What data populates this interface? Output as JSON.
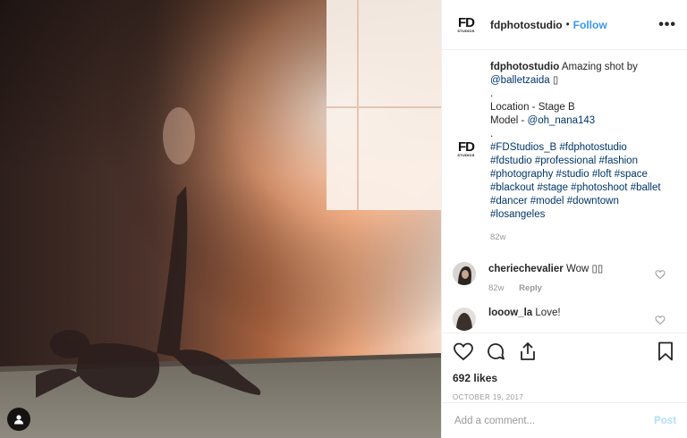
{
  "header": {
    "logo_text": "FD",
    "logo_sub": "STUDIOS",
    "username": "fdphotostudio",
    "separator": "•",
    "follow_label": "Follow",
    "more_label": "•••"
  },
  "caption": {
    "username": "fdphotostudio",
    "line1": "Amazing shot by",
    "mention1": "@balletzaida",
    "emoji1": "▯",
    "dot1": ".",
    "location": "Location - Stage B",
    "model_prefix": "Model - ",
    "mention2": "@oh_nana143",
    "dot2": ".",
    "hashtags": [
      "#FDStudios_B",
      "#fdphotostudio",
      "#fdstudio",
      "#professional",
      "#fashion",
      "#photography",
      "#studio",
      "#loft",
      "#space",
      "#blackout",
      "#stage",
      "#photoshoot",
      "#ballet",
      "#dancer",
      "#model",
      "#downtown",
      "#losangeles"
    ],
    "time": "82w"
  },
  "comments": [
    {
      "username": "cheriechevalier",
      "text": "Wow ▯▯",
      "time": "82w",
      "reply": "Reply"
    },
    {
      "username": "looow_la",
      "text": "Love!"
    }
  ],
  "actions": {
    "like_icon": "heart-icon",
    "comment_icon": "comment-icon",
    "share_icon": "share-icon",
    "save_icon": "bookmark-icon"
  },
  "likes": "692 likes",
  "date": "OCTOBER 19, 2017",
  "add_comment": {
    "placeholder": "Add a comment...",
    "post_label": "Post"
  },
  "colors": {
    "accent": "#3897f0",
    "link": "#003569",
    "muted": "#999999",
    "post_disabled": "#b2dffc"
  }
}
